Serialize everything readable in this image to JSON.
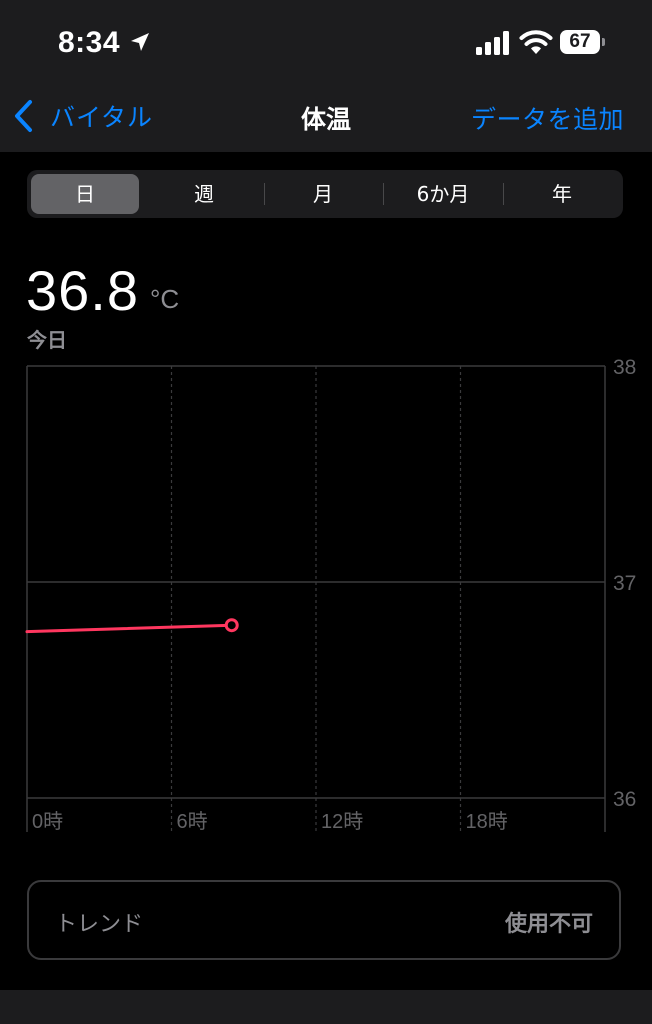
{
  "status_bar": {
    "time": "8:34",
    "battery_level": "67",
    "icons": [
      "location-arrow-icon",
      "cellular-signal-icon",
      "wifi-icon",
      "battery-icon"
    ]
  },
  "nav": {
    "back_label": "バイタル",
    "title": "体温",
    "add_label": "データを追加",
    "accent_color": "#0a84ff"
  },
  "segments": {
    "items": [
      "日",
      "週",
      "月",
      "6か月",
      "年"
    ],
    "selected_index": 0
  },
  "summary": {
    "value": "36.8",
    "unit": "°C",
    "date_label": "今日"
  },
  "chart_data": {
    "type": "line",
    "x_ticks": [
      {
        "value": 0,
        "label": "0時"
      },
      {
        "value": 6,
        "label": "6時"
      },
      {
        "value": 12,
        "label": "12時"
      },
      {
        "value": 18,
        "label": "18時"
      }
    ],
    "xlim": [
      0,
      24
    ],
    "y_ticks": [
      {
        "value": 36,
        "label": "36"
      },
      {
        "value": 37,
        "label": "37"
      },
      {
        "value": 38,
        "label": "38"
      }
    ],
    "ylim": [
      36,
      38
    ],
    "series": [
      {
        "color": "#ff375f",
        "points": [
          {
            "x": 0,
            "y": 36.77
          },
          {
            "x": 8.5,
            "y": 36.8
          }
        ]
      }
    ],
    "grid": true
  },
  "trend": {
    "label": "トレンド",
    "value": "使用不可"
  }
}
